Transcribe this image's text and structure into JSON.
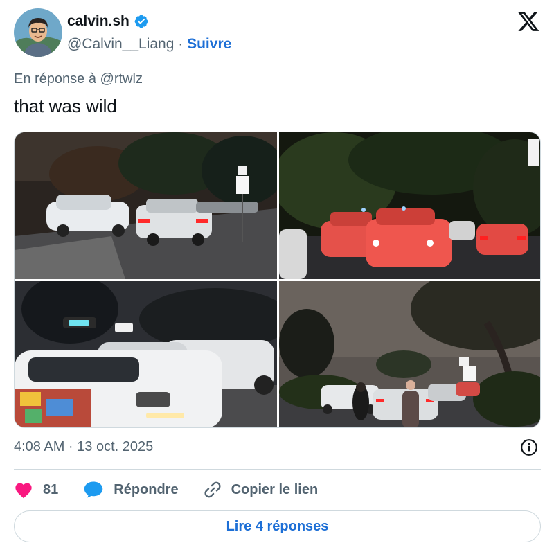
{
  "author": {
    "name": "calvin.sh",
    "handle": "@Calvin__Liang",
    "separator": " · ",
    "follow_label": "Suivre",
    "verified_icon": "verified-badge-icon"
  },
  "tweet": {
    "reply_to": "En réponse à @rtwlz",
    "text": "that was wild",
    "timestamp": "4:08 AM · 13 oct. 2025",
    "photos": [
      "photo-1",
      "photo-2",
      "photo-3",
      "photo-4"
    ]
  },
  "actions": {
    "like_count": "81",
    "reply_label": "Répondre",
    "copy_link_label": "Copier le lien"
  },
  "footer": {
    "read_replies_label": "Lire 4 réponses"
  },
  "colors": {
    "accent": "#1d6fd6",
    "like": "#f91880",
    "muted": "#536471",
    "border": "#cfd9de"
  }
}
